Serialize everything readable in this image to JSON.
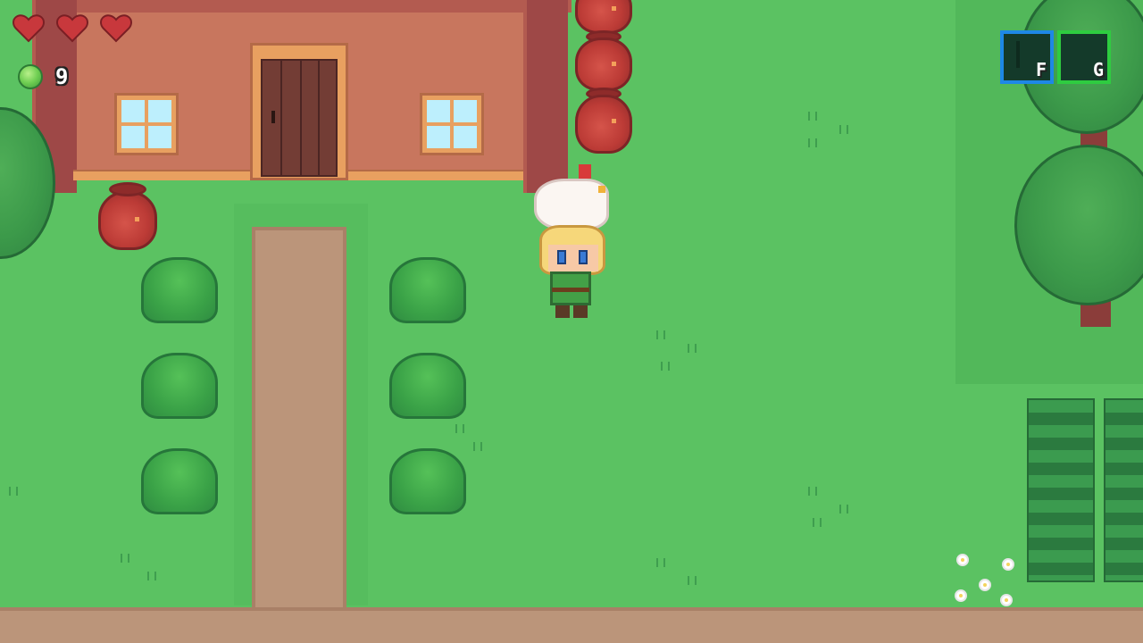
{
  "hud": {
    "hearts": [
      {
        "state": "full",
        "icon": "heart-icon",
        "color": "#c8383c"
      },
      {
        "state": "full",
        "icon": "heart-icon",
        "color": "#c8383c"
      },
      {
        "state": "full",
        "icon": "heart-icon",
        "color": "#c8383c"
      }
    ],
    "currency": {
      "icon": "green-gem-icon",
      "count": "9"
    },
    "item_slots": [
      {
        "key": "F",
        "border_color": "#1e88e5",
        "icon": "empty-slot-icon"
      },
      {
        "key": "G",
        "border_color": "#2ecc40",
        "icon": "empty-slot-icon"
      }
    ]
  },
  "scene": {
    "player": {
      "holding": "chicken"
    },
    "colors": {
      "grass": "#5bc262",
      "path": "#bb957a",
      "house_wall": "#c8765e",
      "pot": "#bc3b36"
    }
  }
}
